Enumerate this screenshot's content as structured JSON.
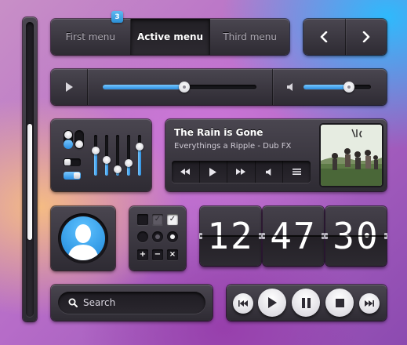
{
  "tabs": {
    "items": [
      {
        "label": "First menu"
      },
      {
        "label": "Active menu"
      },
      {
        "label": "Third menu"
      }
    ],
    "active_index": 1,
    "badge_count": "3"
  },
  "arrows": {
    "prev_icon": "chevron-left-icon",
    "next_icon": "chevron-right-icon"
  },
  "video_bar": {
    "progress": 0.53,
    "volume": 0.68,
    "play_icon": "play-icon",
    "volume_icon": "speaker-icon"
  },
  "controls": {
    "vertical_sliders": [
      0.62,
      0.38,
      0.15,
      0.3,
      0.72
    ],
    "toggles": [
      "on",
      "off"
    ],
    "switches": [
      "off",
      "on"
    ]
  },
  "player": {
    "title": "The Rain is Gone",
    "artist": "Everythings a Ripple - Dub FX",
    "buttons": [
      "rewind-icon",
      "play-icon",
      "fast-forward-icon",
      "volume-icon",
      "menu-icon"
    ]
  },
  "checkgrid": {
    "checkboxes": [
      "dark",
      "checked-dark",
      "checked-white"
    ],
    "radios": [
      "dark",
      "selected-dark",
      "selected-white"
    ],
    "actions": [
      "+",
      "−",
      "×"
    ]
  },
  "clock": {
    "hours": "12",
    "minutes": "47",
    "seconds": "30"
  },
  "search": {
    "placeholder": "Search"
  },
  "media": {
    "buttons": [
      "skip-back-icon",
      "play-icon",
      "pause-icon",
      "stop-icon",
      "skip-forward-icon"
    ]
  },
  "colors": {
    "accent": "#2b8ee0",
    "panel": "#3a363f",
    "text": "#ffffff"
  }
}
